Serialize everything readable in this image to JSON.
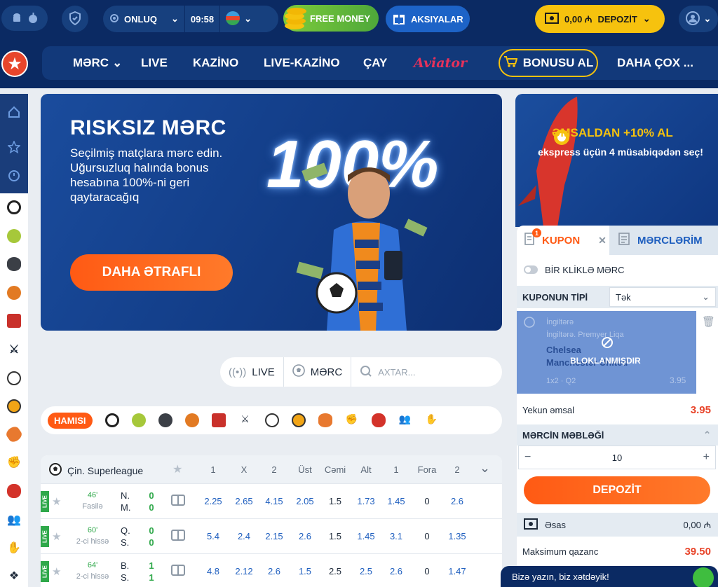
{
  "topbar": {
    "odds_format": "ONLUQ",
    "time": "09:58",
    "free_money": "FREE MONEY",
    "promotions": "AKSIYALAR",
    "balance": "0,00 ₼",
    "deposit": "DEPOZİT"
  },
  "nav": {
    "items": [
      "MƏRC",
      "LIVE",
      "KAZİNO",
      "LIVE-KAZİNO",
      "ÇAY"
    ],
    "aviator": "Aviator",
    "bonus": "BONUSU AL",
    "more": "DAHA ÇOX ..."
  },
  "banner": {
    "title": "RISKSIZ MƏRC",
    "text": "Seçilmiş matçlara mərc edin. Uğursuzluq halında bonus hesabına 100%-ni geri qaytaracağıq",
    "big": "100%",
    "button": "DAHA ƏTRAFLI"
  },
  "promo": {
    "title": "ƏMSALDAN +10% AL",
    "text": "ekspress üçün 4 müsabiqədən seç!"
  },
  "filter": {
    "live": "LIVE",
    "bet": "MƏRC",
    "search_placeholder": "AXTAR..."
  },
  "sports_strip": {
    "all": "HAMISI"
  },
  "table": {
    "league": "Çin. Superleague",
    "headers": [
      "1",
      "X",
      "2",
      "Üst",
      "Cəmi",
      "Alt",
      "1",
      "Fora",
      "2"
    ],
    "live_tag": "LIVE",
    "rows": [
      {
        "minute": "46'",
        "period": "Fasilə",
        "team1": "N.",
        "team2": "M.",
        "score1": "0",
        "score2": "0",
        "odds": [
          "2.25",
          "2.65",
          "4.15",
          "2.05",
          "1.5",
          "1.73",
          "1.45",
          "0",
          "2.6"
        ]
      },
      {
        "minute": "60'",
        "period": "2-ci hissə",
        "team1": "Q.",
        "team2": "S.",
        "score1": "0",
        "score2": "0",
        "odds": [
          "5.4",
          "2.4",
          "2.15",
          "2.6",
          "1.5",
          "1.45",
          "3.1",
          "0",
          "1.35"
        ]
      },
      {
        "minute": "64'",
        "period": "2-ci hissə",
        "team1": "B.",
        "team2": "S.",
        "score1": "1",
        "score2": "1",
        "odds": [
          "4.8",
          "2.12",
          "2.6",
          "1.5",
          "2.5",
          "2.5",
          "2.6",
          "0",
          "1.47"
        ]
      }
    ]
  },
  "coupon": {
    "tab_coupon": "KUPON",
    "badge": "1",
    "tab_bets": "MƏRCLƏRİM",
    "one_click": "BİR KLİKLƏ MƏRC",
    "type_label": "KUPONUN TİPİ",
    "type_value": "Tək",
    "bet_country": "İngiltərə",
    "bet_league": "İngiltərə. Premyer Liqa",
    "bet_team1": "Chelsea",
    "bet_team2": "Manchester United",
    "bet_market": "1x2 · Q2",
    "bet_odd": "3.95",
    "blocked": "BLOKLANMIŞDIR",
    "total_label": "Yekun əmsal",
    "total_value": "3.95",
    "amount_label": "MƏRCİN MƏBLƏĞİ",
    "amount_value": "10",
    "deposit_button": "DEPOZİT",
    "main_label": "Əsas",
    "main_balance": "0,00 ₼",
    "max_win_label": "Maksimum qazanc",
    "max_win_value": "39.50"
  },
  "chat": {
    "text": "Bizə yazın, biz xətdəyik!"
  },
  "colors": {
    "brand": "#0b2a63",
    "accent": "#ff5a14",
    "gold": "#f6c20e",
    "live": "#2fa84a"
  }
}
